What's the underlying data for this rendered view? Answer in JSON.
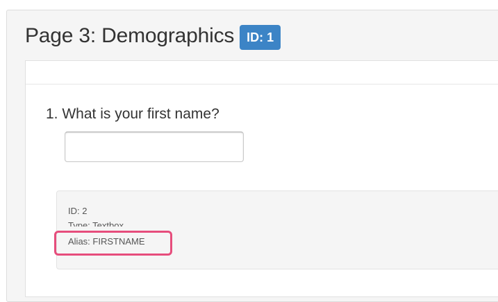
{
  "page": {
    "title": "Page 3: Demographics",
    "id_badge": "ID: 1"
  },
  "question": {
    "number": "1.",
    "text": "1. What is your first name?",
    "input_value": "",
    "input_placeholder": ""
  },
  "question_meta": {
    "id": "ID: 2",
    "type": "Type: Textbox",
    "alias": "Alias: FIRSTNAME"
  },
  "colors": {
    "badge": "#3c84c6",
    "highlight": "#e64d7c"
  }
}
